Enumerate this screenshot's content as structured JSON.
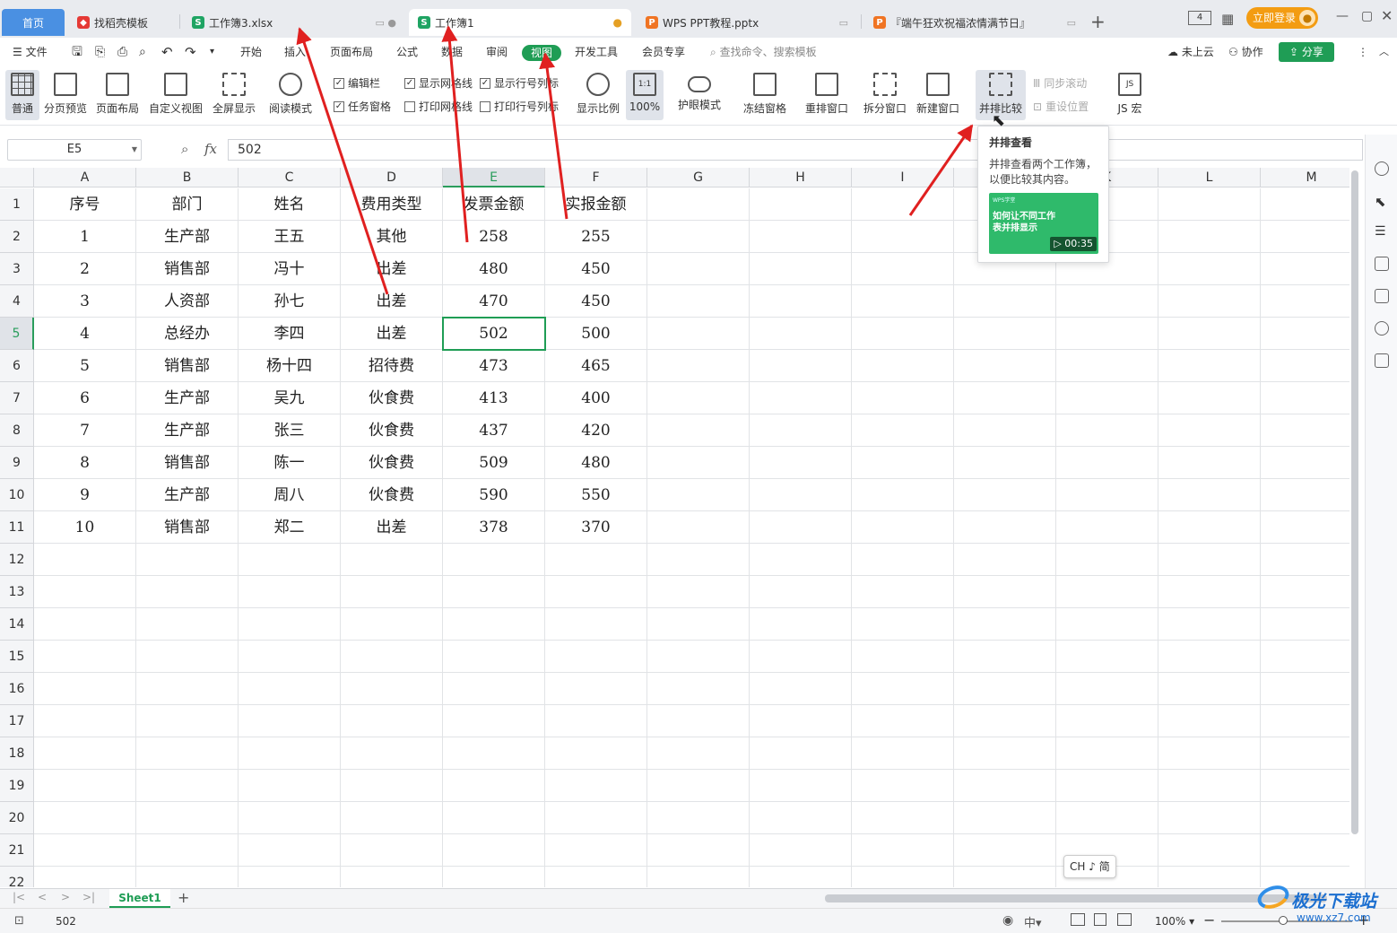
{
  "tabs": {
    "home": "首页",
    "items": [
      {
        "label": "找稻壳模板"
      },
      {
        "label": "工作簿3.xlsx"
      },
      {
        "label": "工作簿1"
      },
      {
        "label": "WPS PPT教程.pptx"
      },
      {
        "label": "『端午狂欢祝福浓情满节日』"
      }
    ],
    "new_tab": "+",
    "login": "立即登录"
  },
  "menu": {
    "file": "文件",
    "items": [
      "开始",
      "插入",
      "页面布局",
      "公式",
      "数据",
      "审阅",
      "视图",
      "开发工具",
      "会员专享"
    ],
    "active": "视图",
    "search_placeholder": "查找命令、搜索模板",
    "cloud": "未上云",
    "collab": "协作",
    "share": "分享"
  },
  "ribbon": {
    "normal": "普通",
    "page_preview": "分页预览",
    "page_layout": "页面布局",
    "custom_view": "自定义视图",
    "fullscreen": "全屏显示",
    "reading_mode": "阅读模式",
    "edit_bar": "编辑栏",
    "task_pane": "任务窗格",
    "show_gridlines": "显示网格线",
    "print_gridlines": "打印网格线",
    "show_row_col": "显示行号列标",
    "print_row_col": "打印行号列标",
    "zoom": "显示比例",
    "zoom_100": "100%",
    "eye_mode": "护眼模式",
    "freeze": "冻结窗格",
    "rearrange": "重排窗口",
    "split": "拆分窗口",
    "new_window": "新建窗口",
    "side_by_side": "并排比较",
    "sync_scroll": "同步滚动",
    "reset_pos": "重设位置",
    "js_macro": "JS 宏"
  },
  "formula": {
    "name_box": "E5",
    "fx": "fx",
    "value": "502"
  },
  "columns": [
    "A",
    "B",
    "C",
    "D",
    "E",
    "F",
    "G",
    "H",
    "I",
    "J",
    "K",
    "L",
    "M"
  ],
  "rows": [
    "1",
    "2",
    "3",
    "4",
    "5",
    "6",
    "7",
    "8",
    "9",
    "10",
    "11",
    "12",
    "13",
    "14",
    "15",
    "16",
    "17",
    "18",
    "19",
    "20",
    "21",
    "22"
  ],
  "table": [
    [
      "序号",
      "部门",
      "姓名",
      "费用类型",
      "发票金额",
      "实报金额"
    ],
    [
      "1",
      "生产部",
      "王五",
      "其他",
      "258",
      "255"
    ],
    [
      "2",
      "销售部",
      "冯十",
      "出差",
      "480",
      "450"
    ],
    [
      "3",
      "人资部",
      "孙七",
      "出差",
      "470",
      "450"
    ],
    [
      "4",
      "总经办",
      "李四",
      "出差",
      "502",
      "500"
    ],
    [
      "5",
      "销售部",
      "杨十四",
      "招待费",
      "473",
      "465"
    ],
    [
      "6",
      "生产部",
      "吴九",
      "伙食费",
      "413",
      "400"
    ],
    [
      "7",
      "生产部",
      "张三",
      "伙食费",
      "437",
      "420"
    ],
    [
      "8",
      "销售部",
      "陈一",
      "伙食费",
      "509",
      "480"
    ],
    [
      "9",
      "生产部",
      "周八",
      "伙食费",
      "590",
      "550"
    ],
    [
      "10",
      "销售部",
      "郑二",
      "出差",
      "378",
      "370"
    ]
  ],
  "tooltip": {
    "title": "并排查看",
    "desc": "并排查看两个工作簿，以便比较其内容。",
    "thumb_brand": "WPS学堂",
    "thumb_text": "如何让不同工作表并排显示",
    "duration": "00:35"
  },
  "ime": "CH ♪ 简",
  "sheet": {
    "name": "Sheet1",
    "add": "+"
  },
  "status": {
    "value": "502",
    "zoom": "100%"
  },
  "watermark": {
    "text": "极光下载站",
    "url": "www.xz7.com"
  },
  "colors": {
    "accent": "#1f9d55",
    "login": "#f39c12",
    "home_tab": "#4a90e2",
    "arrow": "#e02020"
  }
}
